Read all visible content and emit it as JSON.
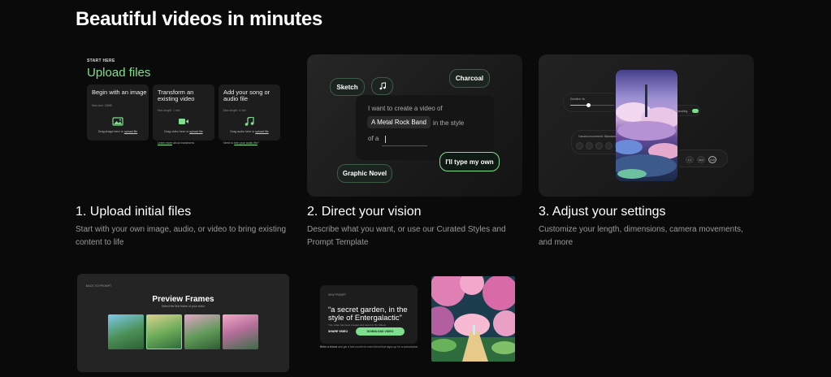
{
  "headline": "Beautiful videos in minutes",
  "step1": {
    "start_here": "START HERE",
    "title": "Upload files",
    "cards": [
      {
        "title": "Begin with an image",
        "sub": "Max size: 20MB",
        "drop": "Drag image here or",
        "link": "upload file",
        "icon": "image-icon"
      },
      {
        "title": "Transform an existing video",
        "sub": "Max length: 1 min",
        "drop": "Drag video here or",
        "link": "upload file",
        "icon": "video-icon"
      },
      {
        "title": "Add your song or audio file",
        "sub": "Max length: 4 min",
        "drop": "Drag audio here or",
        "link": "upload file",
        "icon": "music-note-icon"
      }
    ],
    "learn_more": "Learn more",
    "learn_more_rest": " about transforms",
    "need_to": "Need to ",
    "trim_link": "trim your audio file",
    "trim_rest": "?",
    "caption_title": "1. Upload initial files",
    "caption_desc": "Start with your own image, audio, or video to bring existing content to life"
  },
  "step2": {
    "chips": {
      "sketch": "Sketch",
      "charcoal": "Charcoal",
      "graphic_novel": "Graphic Novel",
      "type_own": "I'll type my own"
    },
    "prompt_line1": "I want to create a video of",
    "band": "A Metal Rock Band",
    "prompt_line2": "in the style",
    "prompt_line3": "of a",
    "caption_title": "2. Direct your vision",
    "caption_desc": "Describe what you want, or use our Curated Styles and Prompt Template"
  },
  "step3": {
    "duration": "Duration 4s",
    "upscaling": "Upscaling",
    "toggle_state": "On",
    "camera": "Camera movement: Standard",
    "ratios": [
      "1:1",
      "16:9",
      "9:16"
    ],
    "caption_title": "3. Adjust your settings",
    "caption_desc": "Customize your length, dimensions, camera movements, and more"
  },
  "preview": {
    "back": "BACK TO PROMPT",
    "title": "Preview Frames",
    "subtitle": "Select the first frame of your video"
  },
  "result": {
    "back": "NEW PROMPT",
    "quote": "“a secret garden, in the style of Entergalactic”",
    "note": "Your video has been created and saved to My Videos",
    "share": "SHARE VIDEO",
    "download": "DOWNLOAD VIDEO",
    "refer_bold": "Refer a friend",
    "refer_rest": " and get a free month for each friend that signs up for a subscription."
  },
  "colors": {
    "accent": "#7ee08f",
    "background": "#0a0a0a"
  }
}
